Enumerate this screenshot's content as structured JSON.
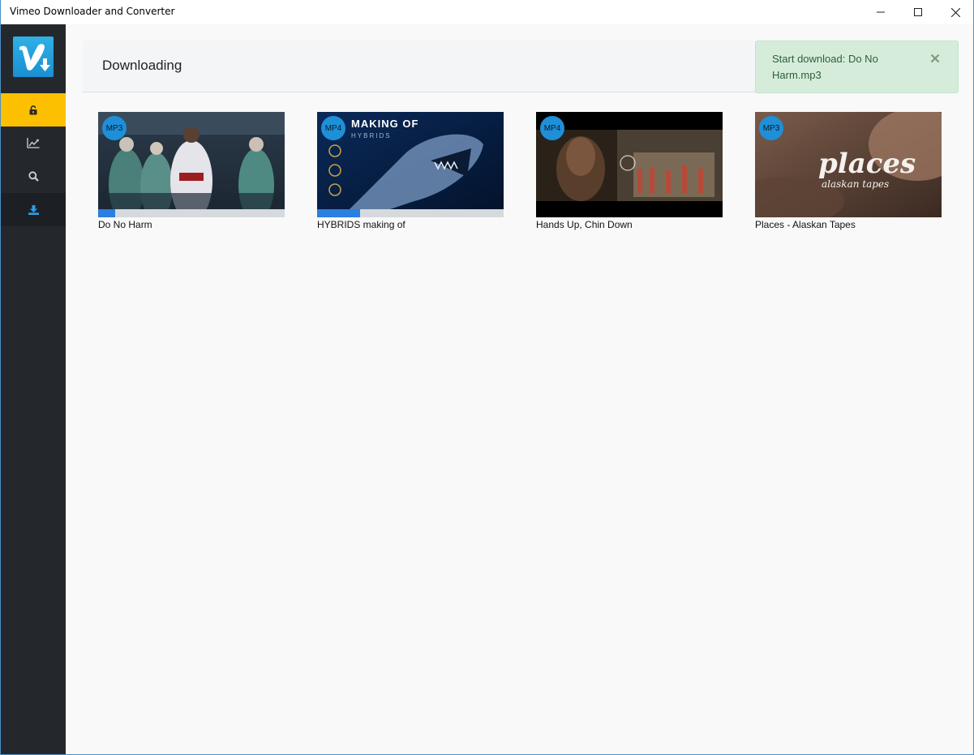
{
  "window": {
    "title": "Vimeo Downloader and Converter"
  },
  "sidebar": {
    "items": [
      {
        "name": "unlock"
      },
      {
        "name": "stats"
      },
      {
        "name": "search"
      },
      {
        "name": "downloads"
      }
    ]
  },
  "header": {
    "title": "Downloading"
  },
  "toast": {
    "message": "Start download: Do No Harm.mp3"
  },
  "downloads": [
    {
      "title": "Do No Harm",
      "format": "MP3",
      "progress": 0.09
    },
    {
      "title": "HYBRIDS making of",
      "format": "MP4",
      "progress": 0.23,
      "overlay_text": "MAKING OF",
      "overlay_sub": "HYBRIDS"
    },
    {
      "title": "Hands Up, Chin Down",
      "format": "MP4",
      "progress": 0
    },
    {
      "title": "Places - Alaskan Tapes",
      "format": "MP3",
      "progress": 0,
      "overlay_text": "places",
      "overlay_sub": "alaskan tapes"
    }
  ],
  "colors": {
    "accent": "#fcc000",
    "brand": "#1a8fd0",
    "progress": "#2a7fe0",
    "toast_bg": "#d5ecdb"
  }
}
